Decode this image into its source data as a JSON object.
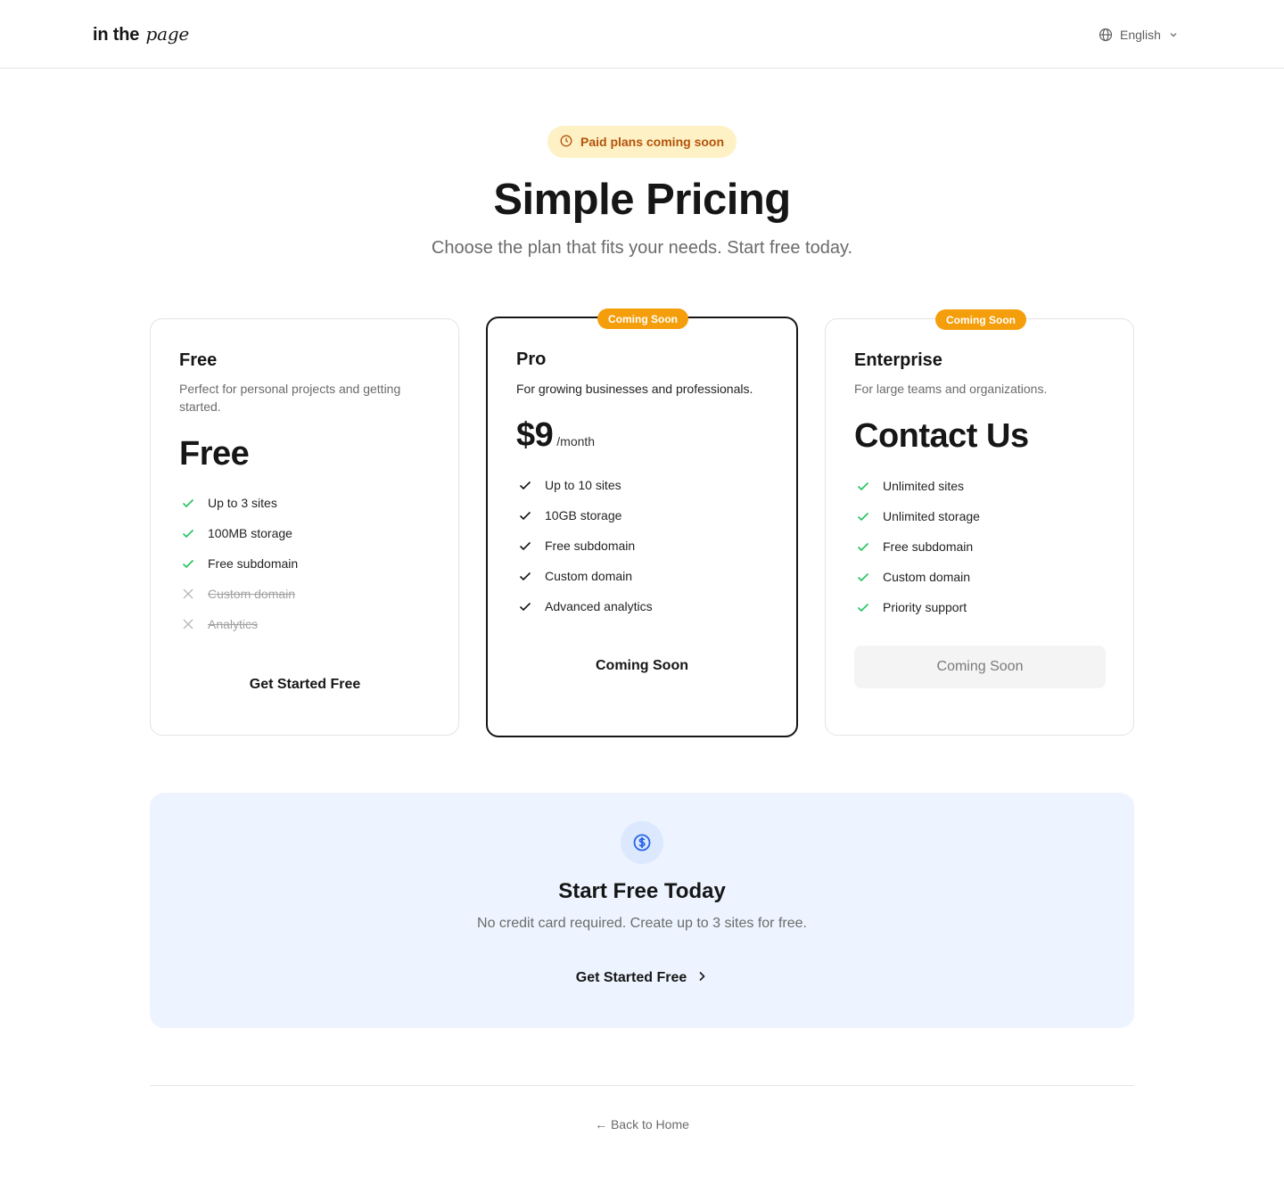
{
  "header": {
    "logo_regular": "in the",
    "logo_italic": "page",
    "language": "English"
  },
  "hero": {
    "badge": "Paid plans coming soon",
    "title": "Simple Pricing",
    "subtitle": "Choose the plan that fits your needs. Start free today."
  },
  "plans": [
    {
      "name": "Free",
      "description": "Perfect for personal projects and getting started.",
      "price": "Free",
      "features": [
        {
          "label": "Up to 3 sites",
          "included": true
        },
        {
          "label": "100MB storage",
          "included": true
        },
        {
          "label": "Free subdomain",
          "included": true
        },
        {
          "label": "Custom domain",
          "included": false
        },
        {
          "label": "Analytics",
          "included": false
        }
      ],
      "button": "Get Started Free"
    },
    {
      "tag": "Coming Soon",
      "name": "Pro",
      "description": "For growing businesses and professionals.",
      "price": "$9",
      "price_unit": "/month",
      "features": [
        {
          "label": "Up to 10 sites",
          "included": true
        },
        {
          "label": "10GB storage",
          "included": true
        },
        {
          "label": "Free subdomain",
          "included": true
        },
        {
          "label": "Custom domain",
          "included": true
        },
        {
          "label": "Advanced analytics",
          "included": true
        }
      ],
      "button": "Coming Soon"
    },
    {
      "tag": "Coming Soon",
      "name": "Enterprise",
      "description": "For large teams and organizations.",
      "price": "Contact Us",
      "features": [
        {
          "label": "Unlimited sites",
          "included": true
        },
        {
          "label": "Unlimited storage",
          "included": true
        },
        {
          "label": "Free subdomain",
          "included": true
        },
        {
          "label": "Custom domain",
          "included": true
        },
        {
          "label": "Priority support",
          "included": true
        }
      ],
      "button": "Coming Soon"
    }
  ],
  "cta": {
    "icon": "dollar-circle-icon",
    "title": "Start Free Today",
    "subtitle": "No credit card required. Create up to 3 sites for free.",
    "button": "Get Started Free"
  },
  "footer": {
    "back_link": "← Back to Home"
  },
  "colors": {
    "badge_bg": "#fdf1c5",
    "badge_text": "#b45309",
    "tag_orange": "#f59e0b",
    "check_green": "#22c55e",
    "cta_bg": "#edf4ff",
    "cta_icon": "#2563eb"
  }
}
